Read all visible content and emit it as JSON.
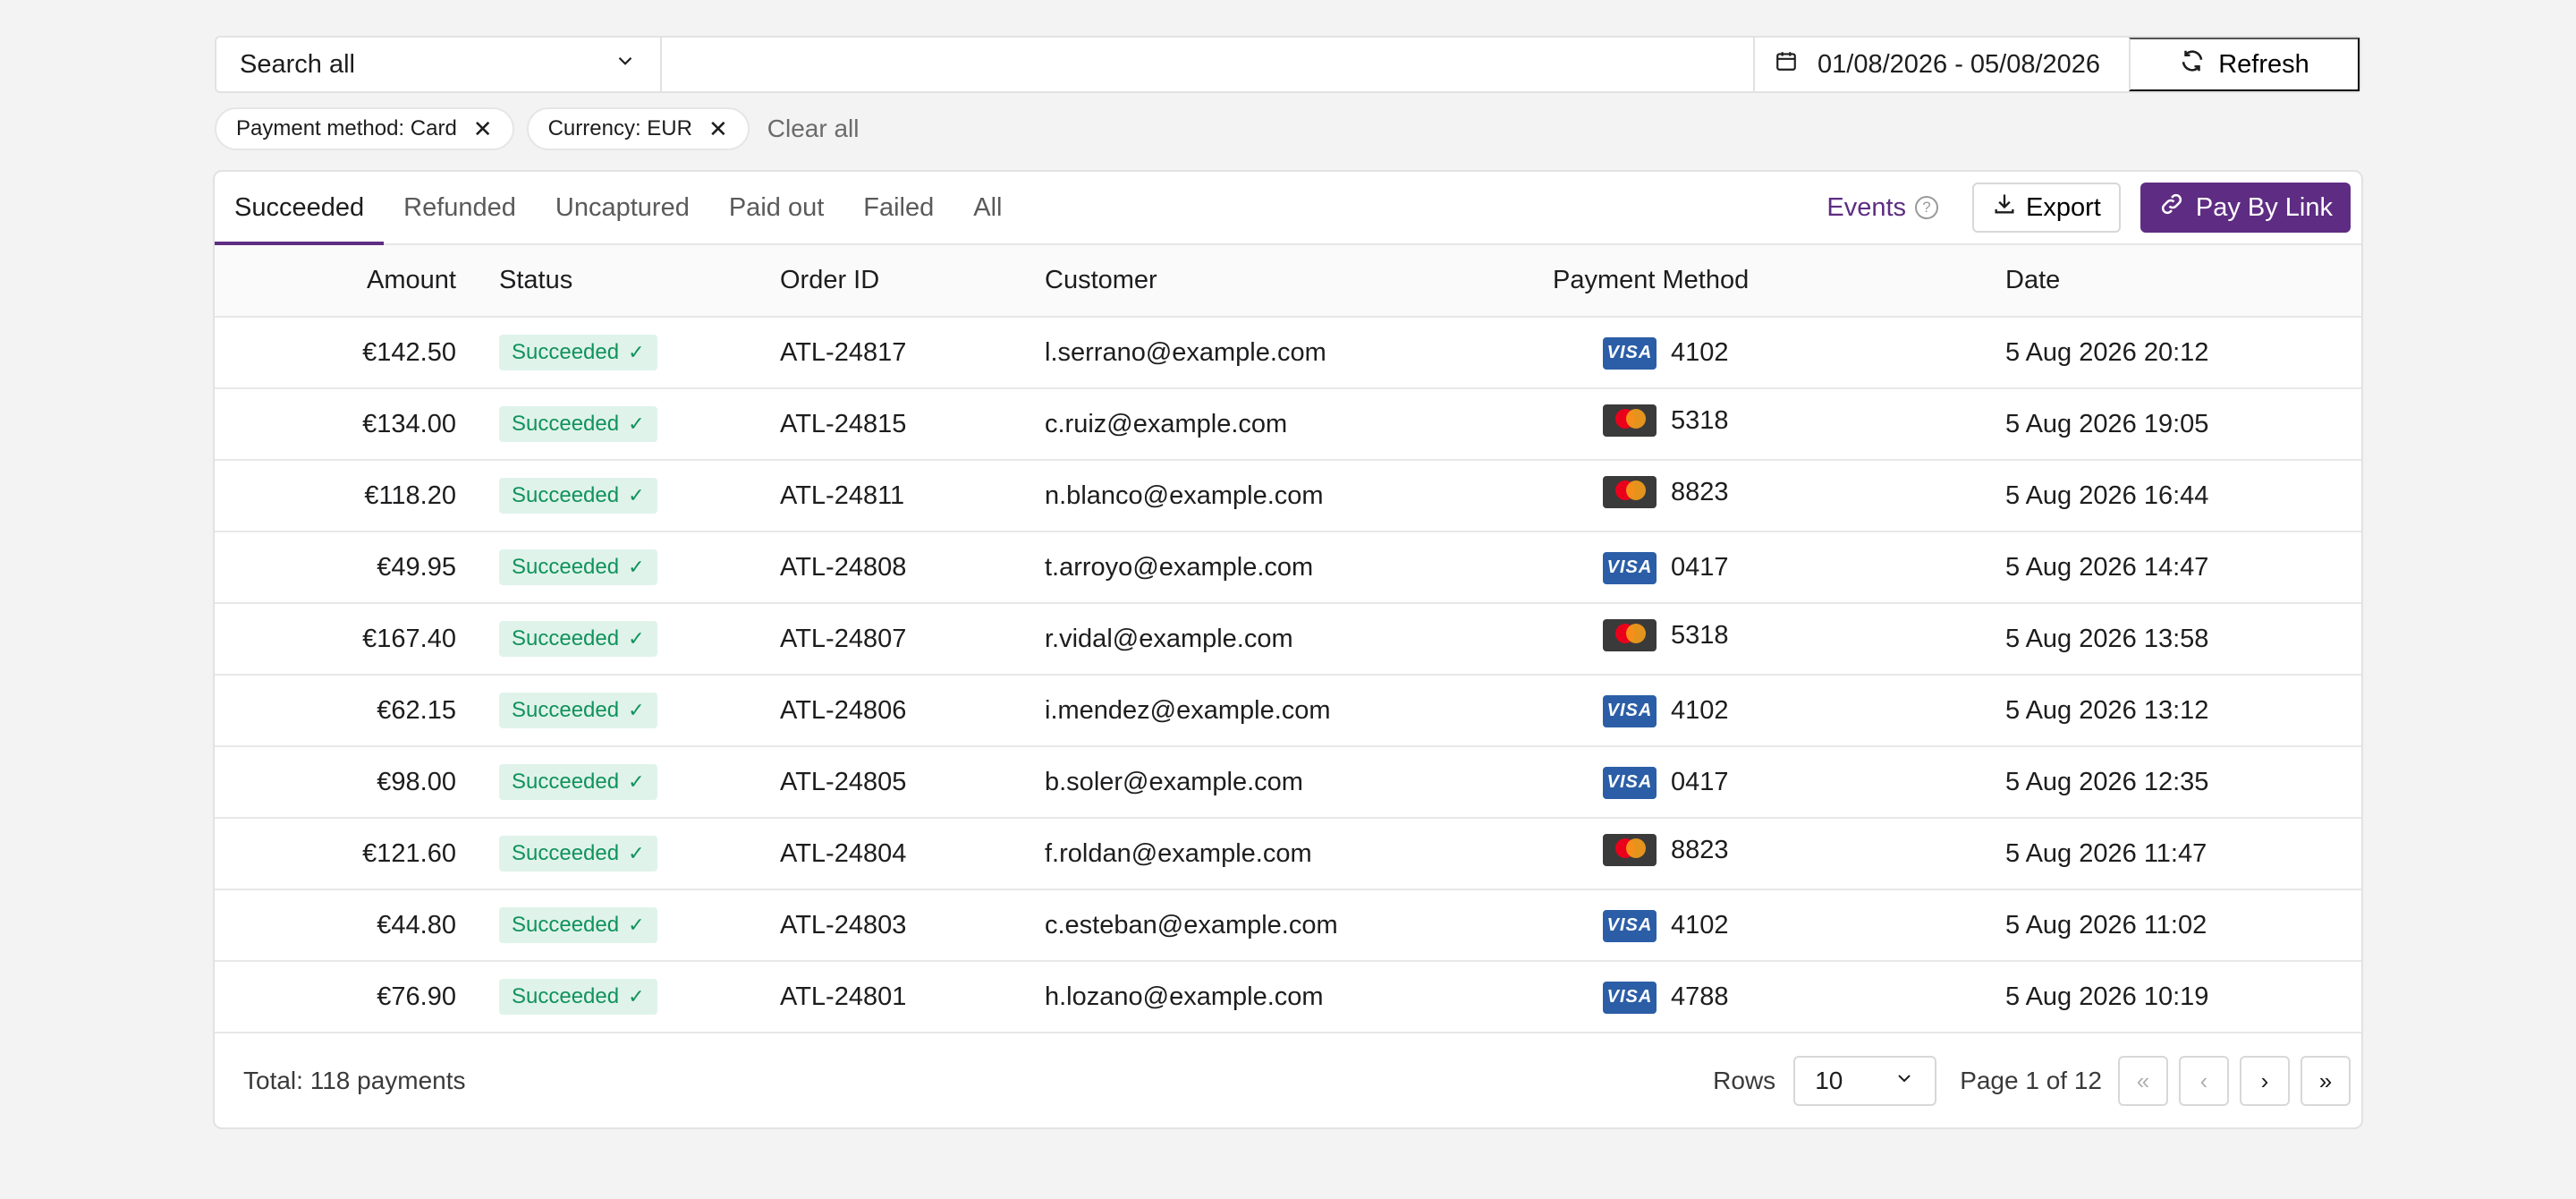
{
  "search": {
    "scope": "Search all",
    "placeholder": "",
    "date_range": "01/08/2026 - 05/08/2026",
    "refresh_label": "Refresh"
  },
  "filters": {
    "chips": [
      "Payment method: Card",
      "Currency: EUR"
    ],
    "clear_label": "Clear all"
  },
  "tabs": [
    "Succeeded",
    "Refunded",
    "Uncaptured",
    "Paid out",
    "Failed",
    "All"
  ],
  "active_tab": "Succeeded",
  "actions": {
    "events_label": "Events",
    "export_label": "Export",
    "pay_link_label": "Pay By Link"
  },
  "table": {
    "columns": [
      "Amount",
      "Status",
      "Order ID",
      "Customer",
      "Payment Method",
      "Date"
    ],
    "rows": [
      {
        "amount": "€142.50",
        "status": "Succeeded",
        "order": "ATL-24817",
        "customer": "l.serrano@example.com",
        "brand": "visa",
        "last4": "4102",
        "date": "5 Aug 2026 20:12"
      },
      {
        "amount": "€134.00",
        "status": "Succeeded",
        "order": "ATL-24815",
        "customer": "c.ruiz@example.com",
        "brand": "mastercard",
        "last4": "5318",
        "date": "5 Aug 2026 19:05"
      },
      {
        "amount": "€118.20",
        "status": "Succeeded",
        "order": "ATL-24811",
        "customer": "n.blanco@example.com",
        "brand": "mastercard",
        "last4": "8823",
        "date": "5 Aug 2026 16:44"
      },
      {
        "amount": "€49.95",
        "status": "Succeeded",
        "order": "ATL-24808",
        "customer": "t.arroyo@example.com",
        "brand": "visa",
        "last4": "0417",
        "date": "5 Aug 2026 14:47"
      },
      {
        "amount": "€167.40",
        "status": "Succeeded",
        "order": "ATL-24807",
        "customer": "r.vidal@example.com",
        "brand": "mastercard",
        "last4": "5318",
        "date": "5 Aug 2026 13:58"
      },
      {
        "amount": "€62.15",
        "status": "Succeeded",
        "order": "ATL-24806",
        "customer": "i.mendez@example.com",
        "brand": "visa",
        "last4": "4102",
        "date": "5 Aug 2026 13:12"
      },
      {
        "amount": "€98.00",
        "status": "Succeeded",
        "order": "ATL-24805",
        "customer": "b.soler@example.com",
        "brand": "visa",
        "last4": "0417",
        "date": "5 Aug 2026 12:35"
      },
      {
        "amount": "€121.60",
        "status": "Succeeded",
        "order": "ATL-24804",
        "customer": "f.roldan@example.com",
        "brand": "mastercard",
        "last4": "8823",
        "date": "5 Aug 2026 11:47"
      },
      {
        "amount": "€44.80",
        "status": "Succeeded",
        "order": "ATL-24803",
        "customer": "c.esteban@example.com",
        "brand": "visa",
        "last4": "4102",
        "date": "5 Aug 2026 11:02"
      },
      {
        "amount": "€76.90",
        "status": "Succeeded",
        "order": "ATL-24801",
        "customer": "h.lozano@example.com",
        "brand": "visa",
        "last4": "4788",
        "date": "5 Aug 2026 10:19"
      }
    ]
  },
  "footer": {
    "total": "Total: 118 payments",
    "rows_label": "Rows",
    "rows_value": "10",
    "page_label": "Page 1 of 12"
  },
  "colors": {
    "accent": "#5e2d83",
    "success_bg": "#dff3ea",
    "success_text": "#11925c",
    "visa": "#2b5ea7",
    "mastercard_bg": "#3a3a3a"
  },
  "icons": {
    "scope_dropdown": "chevron-down-icon",
    "date": "calendar-icon",
    "refresh": "refresh-icon",
    "chip_remove": "close-icon",
    "events_help": "help-icon",
    "export": "download-icon",
    "pay_link": "link-icon",
    "status": "check-icon",
    "pager": [
      "first-page-icon",
      "prev-page-icon",
      "next-page-icon",
      "last-page-icon"
    ]
  }
}
